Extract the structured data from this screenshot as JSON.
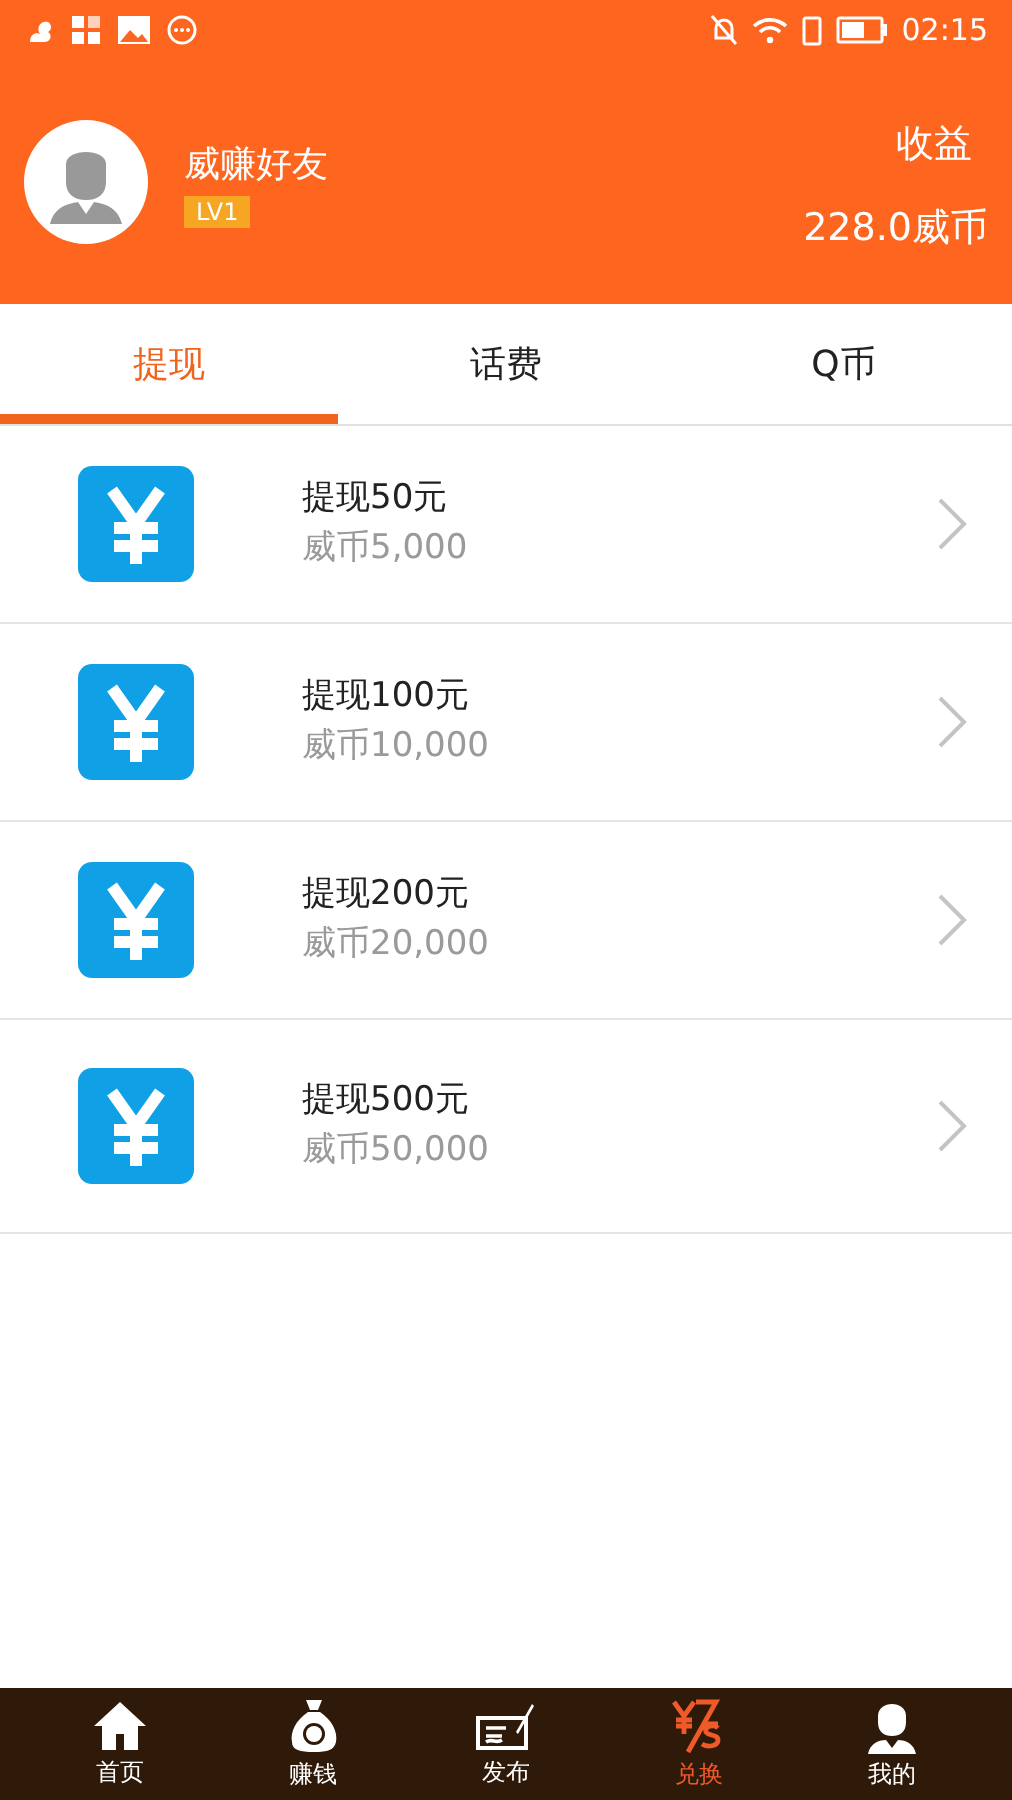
{
  "status_bar": {
    "time": "02:15"
  },
  "profile": {
    "name": "威赚好友",
    "level_badge": "LV1",
    "earnings_label": "收益",
    "earnings_value": "228.0威币"
  },
  "tabs": [
    {
      "label": "提现",
      "selected": true
    },
    {
      "label": "话费",
      "selected": false
    },
    {
      "label": "Q币",
      "selected": false
    }
  ],
  "items": [
    {
      "title": "提现50元",
      "price": "威币5,000"
    },
    {
      "title": "提现100元",
      "price": "威币10,000"
    },
    {
      "title": "提现200元",
      "price": "威币20,000"
    },
    {
      "title": "提现500元",
      "price": "威币50,000"
    }
  ],
  "bottom_nav": [
    {
      "kind": "home",
      "label": "首页",
      "selected": false
    },
    {
      "kind": "money",
      "label": "赚钱",
      "selected": false
    },
    {
      "kind": "publish",
      "label": "发布",
      "selected": false
    },
    {
      "kind": "exchange",
      "label": "兑换",
      "selected": true
    },
    {
      "kind": "me",
      "label": "我的",
      "selected": false
    }
  ]
}
